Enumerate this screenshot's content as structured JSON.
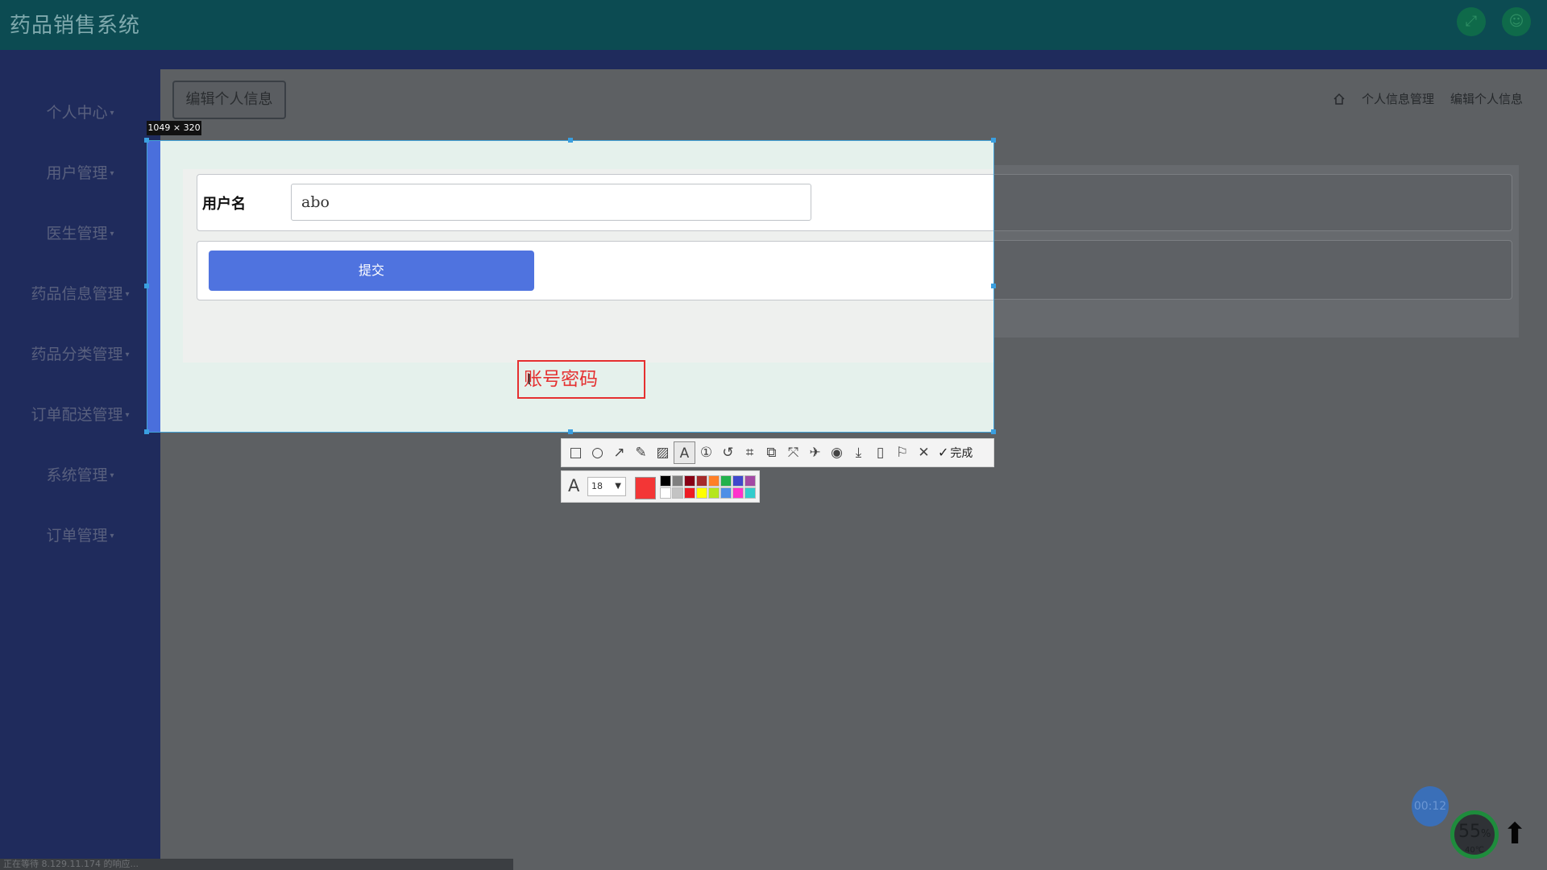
{
  "app": {
    "title": "药品销售系统"
  },
  "topbar_icons": [
    "fullscreen-icon",
    "user-icon"
  ],
  "sidebar": {
    "items": [
      {
        "label": "个人中心"
      },
      {
        "label": "用户管理"
      },
      {
        "label": "医生管理"
      },
      {
        "label": "药品信息管理"
      },
      {
        "label": "药品分类管理"
      },
      {
        "label": "订单配送管理"
      },
      {
        "label": "系统管理"
      },
      {
        "label": "订单管理"
      }
    ]
  },
  "page": {
    "title_button": "编辑个人信息",
    "breadcrumb": [
      "个人信息管理",
      "编辑个人信息"
    ]
  },
  "screenshot_tool": {
    "dimensions": "1049 × 320",
    "annotation_text": "账号密码",
    "font_size": "18",
    "current_color": "#f33636",
    "done_label": "完成",
    "palette": [
      "#000000",
      "#7f7f7f",
      "#880015",
      "#a52a2a",
      "#ff7f27",
      "#22b14c",
      "#3f48cc",
      "#a349a4",
      "#ffffff",
      "#c3c3c3",
      "#ed1c24",
      "#ffff00",
      "#b5e61d",
      "#4f8fe6",
      "#ff33cc",
      "#33cccc"
    ]
  },
  "form": {
    "username_label": "用户名",
    "username_value": "abo",
    "submit_label": "提交"
  },
  "status_bar": {
    "text": "正在等待 8.129.11.174 的响应..."
  },
  "overlay": {
    "timer": "00:12",
    "usage_value": "55",
    "usage_unit": "%",
    "temperature": "40℃"
  }
}
